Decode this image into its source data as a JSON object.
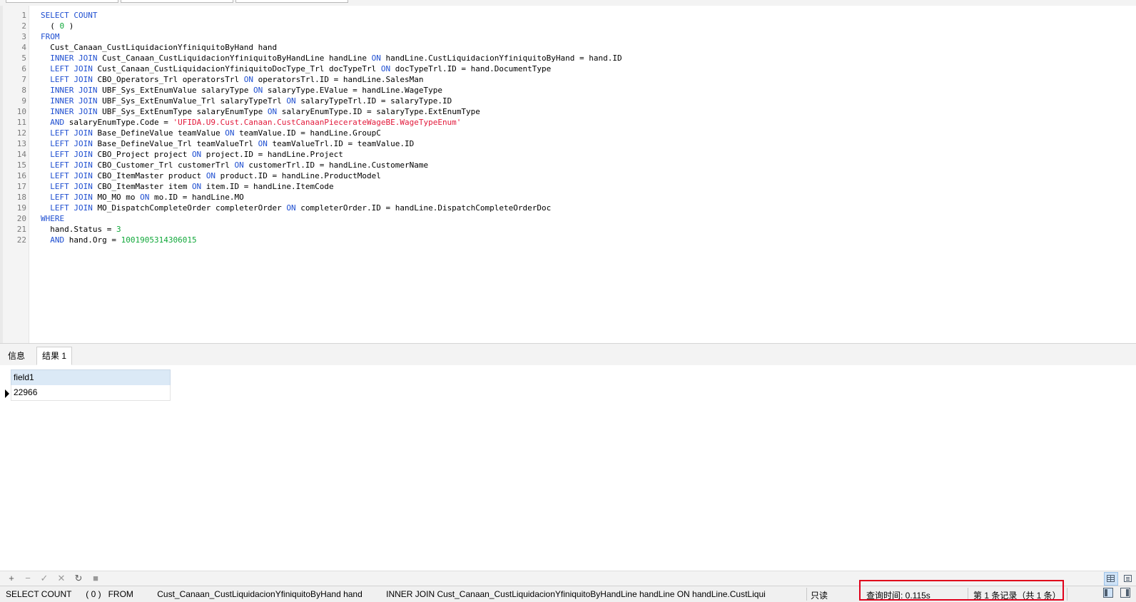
{
  "editor": {
    "lines": [
      {
        "n": "1",
        "tokens": [
          {
            "t": "SELECT COUNT",
            "c": "kw"
          }
        ]
      },
      {
        "n": "2",
        "tokens": [
          {
            "t": "  ( ",
            "c": ""
          },
          {
            "t": "0",
            "c": "num"
          },
          {
            "t": " )",
            "c": ""
          }
        ]
      },
      {
        "n": "3",
        "tokens": [
          {
            "t": "FROM",
            "c": "kw"
          }
        ]
      },
      {
        "n": "4",
        "tokens": [
          {
            "t": "  Cust_Canaan_CustLiquidacionYfiniquitoByHand hand",
            "c": ""
          }
        ]
      },
      {
        "n": "5",
        "tokens": [
          {
            "t": "  INNER JOIN",
            "c": "kw"
          },
          {
            "t": " Cust_Canaan_CustLiquidacionYfiniquitoByHandLine handLine ",
            "c": ""
          },
          {
            "t": "ON",
            "c": "kw"
          },
          {
            "t": " handLine.CustLiquidacionYfiniquitoByHand = hand.ID",
            "c": ""
          }
        ]
      },
      {
        "n": "6",
        "tokens": [
          {
            "t": "  LEFT JOIN",
            "c": "kw"
          },
          {
            "t": " Cust_Canaan_CustLiquidacionYfiniquitoDocType_Trl docTypeTrl ",
            "c": ""
          },
          {
            "t": "ON",
            "c": "kw"
          },
          {
            "t": " docTypeTrl.ID = hand.DocumentType",
            "c": ""
          }
        ]
      },
      {
        "n": "7",
        "tokens": [
          {
            "t": "  LEFT JOIN",
            "c": "kw"
          },
          {
            "t": " CBO_Operators_Trl operatorsTrl ",
            "c": ""
          },
          {
            "t": "ON",
            "c": "kw"
          },
          {
            "t": " operatorsTrl.ID = handLine.SalesMan",
            "c": ""
          }
        ]
      },
      {
        "n": "8",
        "tokens": [
          {
            "t": "  INNER JOIN",
            "c": "kw"
          },
          {
            "t": " UBF_Sys_ExtEnumValue salaryType ",
            "c": ""
          },
          {
            "t": "ON",
            "c": "kw"
          },
          {
            "t": " salaryType.EValue = handLine.WageType",
            "c": ""
          }
        ]
      },
      {
        "n": "9",
        "tokens": [
          {
            "t": "  INNER JOIN",
            "c": "kw"
          },
          {
            "t": " UBF_Sys_ExtEnumValue_Trl salaryTypeTrl ",
            "c": ""
          },
          {
            "t": "ON",
            "c": "kw"
          },
          {
            "t": " salaryTypeTrl.ID = salaryType.ID",
            "c": ""
          }
        ]
      },
      {
        "n": "10",
        "tokens": [
          {
            "t": "  INNER JOIN",
            "c": "kw"
          },
          {
            "t": " UBF_Sys_ExtEnumType salaryEnumType ",
            "c": ""
          },
          {
            "t": "ON",
            "c": "kw"
          },
          {
            "t": " salaryEnumType.ID = salaryType.ExtEnumType",
            "c": ""
          }
        ]
      },
      {
        "n": "11",
        "tokens": [
          {
            "t": "  AND",
            "c": "kw"
          },
          {
            "t": " salaryEnumType.Code = ",
            "c": ""
          },
          {
            "t": "'UFIDA.U9.Cust.Canaan.CustCanaanPiecerateWageBE.WageTypeEnum'",
            "c": "str"
          }
        ]
      },
      {
        "n": "12",
        "tokens": [
          {
            "t": "  LEFT JOIN",
            "c": "kw"
          },
          {
            "t": " Base_DefineValue teamValue ",
            "c": ""
          },
          {
            "t": "ON",
            "c": "kw"
          },
          {
            "t": " teamValue.ID = handLine.GroupC",
            "c": ""
          }
        ]
      },
      {
        "n": "13",
        "tokens": [
          {
            "t": "  LEFT JOIN",
            "c": "kw"
          },
          {
            "t": " Base_DefineValue_Trl teamValueTrl ",
            "c": ""
          },
          {
            "t": "ON",
            "c": "kw"
          },
          {
            "t": " teamValueTrl.ID = teamValue.ID",
            "c": ""
          }
        ]
      },
      {
        "n": "14",
        "tokens": [
          {
            "t": "  LEFT JOIN",
            "c": "kw"
          },
          {
            "t": " CBO_Project project ",
            "c": ""
          },
          {
            "t": "ON",
            "c": "kw"
          },
          {
            "t": " project.ID = handLine.Project",
            "c": ""
          }
        ]
      },
      {
        "n": "15",
        "tokens": [
          {
            "t": "  LEFT JOIN",
            "c": "kw"
          },
          {
            "t": " CBO_Customer_Trl customerTrl ",
            "c": ""
          },
          {
            "t": "ON",
            "c": "kw"
          },
          {
            "t": " customerTrl.ID = handLine.CustomerName",
            "c": ""
          }
        ]
      },
      {
        "n": "16",
        "tokens": [
          {
            "t": "  LEFT JOIN",
            "c": "kw"
          },
          {
            "t": " CBO_ItemMaster product ",
            "c": ""
          },
          {
            "t": "ON",
            "c": "kw"
          },
          {
            "t": " product.ID = handLine.ProductModel",
            "c": ""
          }
        ]
      },
      {
        "n": "17",
        "tokens": [
          {
            "t": "  LEFT JOIN",
            "c": "kw"
          },
          {
            "t": " CBO_ItemMaster item ",
            "c": ""
          },
          {
            "t": "ON",
            "c": "kw"
          },
          {
            "t": " item.ID = handLine.ItemCode",
            "c": ""
          }
        ]
      },
      {
        "n": "18",
        "tokens": [
          {
            "t": "  LEFT JOIN",
            "c": "kw"
          },
          {
            "t": " MO_MO mo ",
            "c": ""
          },
          {
            "t": "ON",
            "c": "kw"
          },
          {
            "t": " mo.ID = handLine.MO",
            "c": ""
          }
        ]
      },
      {
        "n": "19",
        "tokens": [
          {
            "t": "  LEFT JOIN",
            "c": "kw"
          },
          {
            "t": " MO_DispatchCompleteOrder completerOrder ",
            "c": ""
          },
          {
            "t": "ON",
            "c": "kw"
          },
          {
            "t": " completerOrder.ID = handLine.DispatchCompleteOrderDoc",
            "c": ""
          }
        ]
      },
      {
        "n": "20",
        "tokens": [
          {
            "t": "WHERE",
            "c": "kw"
          }
        ]
      },
      {
        "n": "21",
        "tokens": [
          {
            "t": "  hand.Status = ",
            "c": ""
          },
          {
            "t": "3",
            "c": "num"
          }
        ]
      },
      {
        "n": "22",
        "tokens": [
          {
            "t": "  AND",
            "c": "kw"
          },
          {
            "t": " hand.Org = ",
            "c": ""
          },
          {
            "t": "1001905314306015",
            "c": "num"
          }
        ]
      }
    ]
  },
  "result_tabs": [
    {
      "label": "信息",
      "active": false
    },
    {
      "label": "结果 1",
      "active": true
    }
  ],
  "grid": {
    "columns": [
      "field1"
    ],
    "rows": [
      [
        "22966"
      ]
    ]
  },
  "nav_buttons": [
    {
      "icon": "plus-icon",
      "glyph": "+"
    },
    {
      "icon": "minus-icon",
      "glyph": "−"
    },
    {
      "icon": "check-icon",
      "glyph": "✓"
    },
    {
      "icon": "cross-icon",
      "glyph": "✕"
    },
    {
      "icon": "refresh-icon",
      "glyph": "↻"
    },
    {
      "icon": "stop-icon",
      "glyph": "■"
    }
  ],
  "view_buttons": [
    {
      "icon": "grid-view-icon",
      "selected": true
    },
    {
      "icon": "form-view-icon",
      "selected": false
    }
  ],
  "status": {
    "sql": "SELECT COUNT      ( 0 )   FROM          Cust_Canaan_CustLiquidacionYfiniquitoByHand hand          INNER JOIN Cust_Canaan_CustLiquidacionYfiniquitoByHandLine handLine ON handLine.CustLiqui",
    "mode": "只读",
    "query_time": "查询时间: 0.115s",
    "record": "第 1 条记录（共 1 条）"
  },
  "colors": {
    "keyword": "#1f4fd1",
    "string": "#e2183a",
    "number": "#11a83a",
    "highlight": "#e0001b"
  }
}
